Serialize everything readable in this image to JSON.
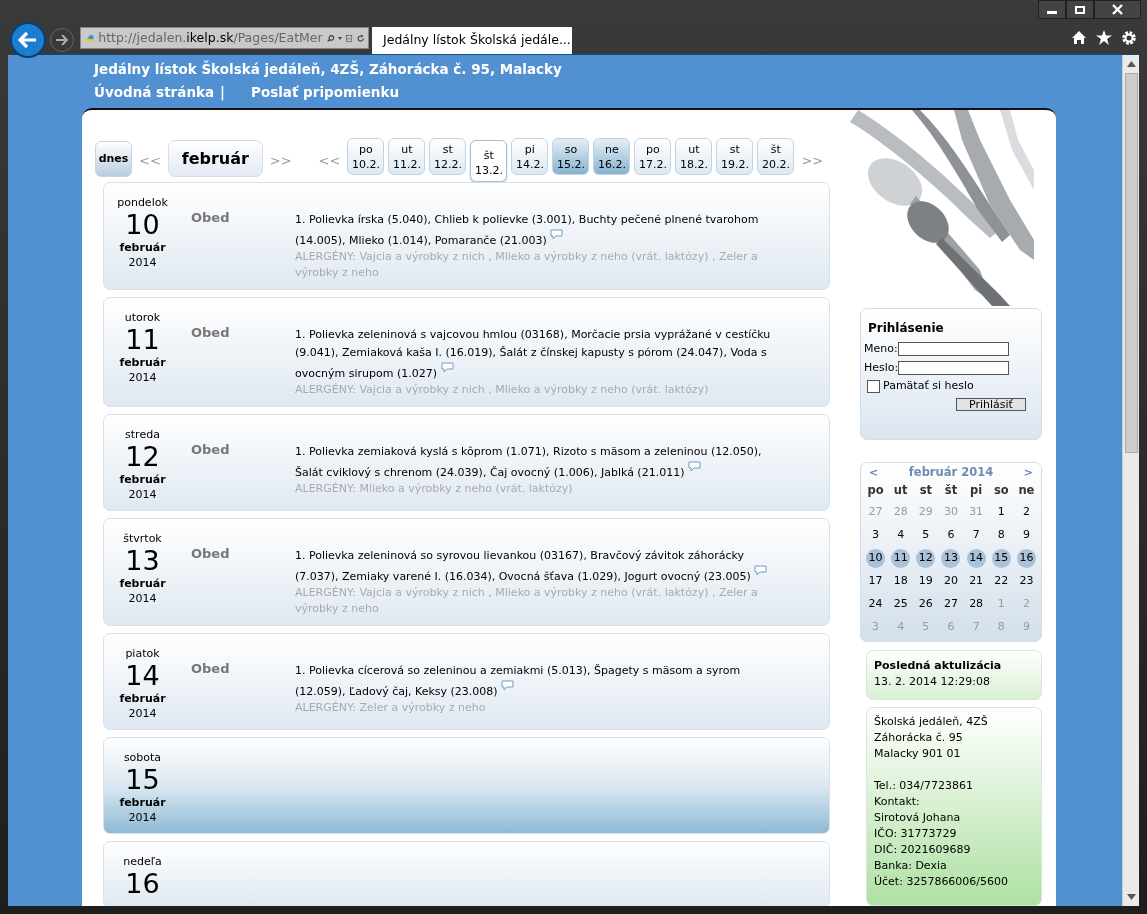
{
  "browser": {
    "address_prefix": "http://jedalen.",
    "address_domain": "ikelp.sk",
    "address_path": "/Pages/EatMer",
    "tab_title": "Jedálny lístok Školská jedále..."
  },
  "header": {
    "title": "Jedálny lístok Školská jedáleň, 4ZŠ, Záhorácka č. 95, Malacky",
    "nav": [
      "Úvodná stránka",
      "Poslať pripomienku"
    ],
    "separator": "|"
  },
  "date_nav": {
    "today": "dnes",
    "month_prev": "<<",
    "month": "február",
    "month_next": ">>",
    "week_prev": "<<",
    "week_next": ">>",
    "days": [
      {
        "weekday": "po",
        "date": "10.2.",
        "selected": false,
        "weekend": false
      },
      {
        "weekday": "ut",
        "date": "11.2.",
        "selected": false,
        "weekend": false
      },
      {
        "weekday": "st",
        "date": "12.2.",
        "selected": false,
        "weekend": false
      },
      {
        "weekday": "št",
        "date": "13.2.",
        "selected": true,
        "weekend": false
      },
      {
        "weekday": "pi",
        "date": "14.2.",
        "selected": false,
        "weekend": false
      },
      {
        "weekday": "so",
        "date": "15.2.",
        "selected": false,
        "weekend": true
      },
      {
        "weekday": "ne",
        "date": "16.2.",
        "selected": false,
        "weekend": true
      },
      {
        "weekday": "po",
        "date": "17.2.",
        "selected": false,
        "weekend": false
      },
      {
        "weekday": "ut",
        "date": "18.2.",
        "selected": false,
        "weekend": false
      },
      {
        "weekday": "st",
        "date": "19.2.",
        "selected": false,
        "weekend": false
      },
      {
        "weekday": "št",
        "date": "20.2.",
        "selected": false,
        "weekend": false
      }
    ]
  },
  "menu_days": [
    {
      "weekday": "pondelok",
      "day": "10",
      "month": "február",
      "year": "2014",
      "weekend": false,
      "meal": "Obed",
      "menu": "1. Polievka írska (5.040), Chlieb k polievke (3.001), Buchty pečené plnené  tvarohom (14.005), Mlieko (1.014), Pomaranče (21.003)",
      "allergens": "ALERGÉNY: Vajcia a výrobky z nich , Mlieko a výrobky z neho (vrát. laktózy) , Zeler a výrobky z neho"
    },
    {
      "weekday": "utorok",
      "day": "11",
      "month": "február",
      "year": "2014",
      "weekend": false,
      "meal": "Obed",
      "menu": "1. Polievka zeleninová s vajcovou hmlou (03168), Morčacie prsia vyprážané v cestíčku (9.041), Zemiaková kaša I. (16.019), Šalát z čínskej kapusty s pórom (24.047), Voda s ovocným sirupom (1.027)",
      "allergens": "ALERGÉNY: Vajcia a výrobky z nich , Mlieko a výrobky z neho (vrát. laktózy)"
    },
    {
      "weekday": "streda",
      "day": "12",
      "month": "február",
      "year": "2014",
      "weekend": false,
      "meal": "Obed",
      "menu": "1. Polievka zemiaková kyslá s kôprom (1.071), Rizoto s mäsom a zeleninou (12.050), Šalát cviklový s chrenom (24.039), Čaj ovocný (1.006), Jablká (21.011)",
      "allergens": "ALERGÉNY: Mlieko a výrobky z neho (vrát. laktózy)"
    },
    {
      "weekday": "štvrtok",
      "day": "13",
      "month": "február",
      "year": "2014",
      "weekend": false,
      "meal": "Obed",
      "menu": "1. Polievka zeleninová so syrovou lievankou (03167), Bravčový závitok záhorácky (7.037), Zemiaky varené I. (16.034), Ovocná šťava (1.029), Jogurt ovocný (23.005)",
      "allergens": "ALERGÉNY: Vajcia a výrobky z nich , Mlieko a výrobky z neho (vrát. laktózy) , Zeler a výrobky z neho"
    },
    {
      "weekday": "piatok",
      "day": "14",
      "month": "február",
      "year": "2014",
      "weekend": false,
      "meal": "Obed",
      "menu": "1. Polievka cícerová so zeleninou a zemiakmi (5.013), Špagety s mäsom a syrom (12.059), Ľadový čaj, Keksy (23.008)",
      "allergens": "ALERGÉNY: Zeler a výrobky z neho"
    },
    {
      "weekday": "sobota",
      "day": "15",
      "month": "február",
      "year": "2014",
      "weekend": true
    },
    {
      "weekday": "nedeľa",
      "day": "16",
      "weekend": false
    }
  ],
  "login": {
    "title": "Prihlásenie",
    "username_label": "Meno:",
    "password_label": "Heslo:",
    "remember_label": "Pamätať si heslo",
    "remember_checked": false,
    "button": "Prihlásiť"
  },
  "calendar": {
    "title": "február 2014",
    "prev": "<",
    "next": ">",
    "weekdays": [
      "po",
      "ut",
      "st",
      "št",
      "pi",
      "so",
      "ne"
    ],
    "weeks": [
      [
        {
          "text": "27",
          "other_month": true,
          "selected": false
        },
        {
          "text": "28",
          "other_month": true,
          "selected": false
        },
        {
          "text": "29",
          "other_month": true,
          "selected": false
        },
        {
          "text": "30",
          "other_month": true,
          "selected": false
        },
        {
          "text": "31",
          "other_month": true,
          "selected": false
        },
        {
          "text": "1",
          "other_month": false,
          "selected": false
        },
        {
          "text": "2",
          "other_month": false,
          "selected": false
        }
      ],
      [
        {
          "text": "3",
          "other_month": false,
          "selected": false
        },
        {
          "text": "4",
          "other_month": false,
          "selected": false
        },
        {
          "text": "5",
          "other_month": false,
          "selected": false
        },
        {
          "text": "6",
          "other_month": false,
          "selected": false
        },
        {
          "text": "7",
          "other_month": false,
          "selected": false
        },
        {
          "text": "8",
          "other_month": false,
          "selected": false
        },
        {
          "text": "9",
          "other_month": false,
          "selected": false
        }
      ],
      [
        {
          "text": "10",
          "other_month": false,
          "selected": true
        },
        {
          "text": "11",
          "other_month": false,
          "selected": true
        },
        {
          "text": "12",
          "other_month": false,
          "selected": true
        },
        {
          "text": "13",
          "other_month": false,
          "selected": true
        },
        {
          "text": "14",
          "other_month": false,
          "selected": true
        },
        {
          "text": "15",
          "other_month": false,
          "selected": true
        },
        {
          "text": "16",
          "other_month": false,
          "selected": true
        }
      ],
      [
        {
          "text": "17",
          "other_month": false,
          "selected": false
        },
        {
          "text": "18",
          "other_month": false,
          "selected": false
        },
        {
          "text": "19",
          "other_month": false,
          "selected": false
        },
        {
          "text": "20",
          "other_month": false,
          "selected": false
        },
        {
          "text": "21",
          "other_month": false,
          "selected": false
        },
        {
          "text": "22",
          "other_month": false,
          "selected": false
        },
        {
          "text": "23",
          "other_month": false,
          "selected": false
        }
      ],
      [
        {
          "text": "24",
          "other_month": false,
          "selected": false
        },
        {
          "text": "25",
          "other_month": false,
          "selected": false
        },
        {
          "text": "26",
          "other_month": false,
          "selected": false
        },
        {
          "text": "27",
          "other_month": false,
          "selected": false
        },
        {
          "text": "28",
          "other_month": false,
          "selected": false
        },
        {
          "text": "1",
          "other_month": true,
          "selected": false
        },
        {
          "text": "2",
          "other_month": true,
          "selected": false
        }
      ],
      [
        {
          "text": "3",
          "other_month": true,
          "selected": false
        },
        {
          "text": "4",
          "other_month": true,
          "selected": false
        },
        {
          "text": "5",
          "other_month": true,
          "selected": false
        },
        {
          "text": "6",
          "other_month": true,
          "selected": false
        },
        {
          "text": "7",
          "other_month": true,
          "selected": false
        },
        {
          "text": "8",
          "other_month": true,
          "selected": false
        },
        {
          "text": "9",
          "other_month": true,
          "selected": false
        }
      ]
    ]
  },
  "last_update": {
    "title": "Posledná aktulizácia",
    "value": "13. 2. 2014 12:29:08"
  },
  "contact": [
    [
      "Školská jedáleň, 4ZŠ",
      "Záhorácka č. 95",
      "Malacky 901 01"
    ],
    [
      "Tel.: 034/7723861",
      "Kontakt:",
      "Sirotová Johana",
      "IČO: 31773729",
      "DIČ: 2021609689",
      "Banka: Dexia",
      "Účet: 3257866006/5600"
    ]
  ]
}
